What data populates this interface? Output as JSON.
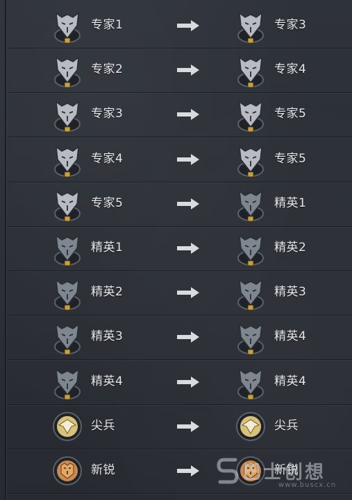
{
  "rank_table": {
    "arrow_icon": "right-arrow-icon",
    "rows": [
      {
        "from": {
          "label": "专家1",
          "badge": "expert-wolf-badge-icon",
          "tier": "I"
        },
        "to": {
          "label": "专家3",
          "badge": "expert-wolf-badge-icon",
          "tier": "III"
        }
      },
      {
        "from": {
          "label": "专家2",
          "badge": "expert-wolf-badge-icon",
          "tier": "II"
        },
        "to": {
          "label": "专家4",
          "badge": "expert-wolf-badge-icon",
          "tier": "IV"
        }
      },
      {
        "from": {
          "label": "专家3",
          "badge": "expert-wolf-badge-icon",
          "tier": "III"
        },
        "to": {
          "label": "专家5",
          "badge": "expert-wolf-badge-icon",
          "tier": "V"
        }
      },
      {
        "from": {
          "label": "专家4",
          "badge": "expert-wolf-badge-icon",
          "tier": "IV"
        },
        "to": {
          "label": "专家5",
          "badge": "expert-wolf-badge-icon",
          "tier": "V"
        }
      },
      {
        "from": {
          "label": "专家5",
          "badge": "expert-wolf-badge-icon",
          "tier": "V"
        },
        "to": {
          "label": "精英1",
          "badge": "elite-wolf-badge-icon",
          "tier": "I"
        }
      },
      {
        "from": {
          "label": "精英1",
          "badge": "elite-wolf-badge-icon",
          "tier": "I"
        },
        "to": {
          "label": "精英2",
          "badge": "elite-wolf-badge-icon",
          "tier": "II"
        }
      },
      {
        "from": {
          "label": "精英2",
          "badge": "elite-wolf-badge-icon",
          "tier": "II"
        },
        "to": {
          "label": "精英3",
          "badge": "elite-wolf-badge-icon",
          "tier": "III"
        }
      },
      {
        "from": {
          "label": "精英3",
          "badge": "elite-wolf-badge-icon",
          "tier": "III"
        },
        "to": {
          "label": "精英4",
          "badge": "elite-wolf-badge-icon",
          "tier": "IV"
        }
      },
      {
        "from": {
          "label": "精英4",
          "badge": "elite-wolf-badge-icon",
          "tier": "IV"
        },
        "to": {
          "label": "精英4",
          "badge": "elite-wolf-badge-icon",
          "tier": "IV"
        }
      },
      {
        "from": {
          "label": "尖兵",
          "badge": "vanguard-eagle-badge-icon",
          "tier": ""
        },
        "to": {
          "label": "尖兵",
          "badge": "vanguard-eagle-badge-icon",
          "tier": ""
        }
      },
      {
        "from": {
          "label": "新锐",
          "badge": "rookie-tiger-badge-icon",
          "tier": ""
        },
        "to": {
          "label": "新锐",
          "badge": "rookie-tiger-badge-icon",
          "tier": ""
        }
      }
    ]
  },
  "colors": {
    "background": "#2b2f35",
    "label_text": "#e6e8ea",
    "arrow": "#d9dcdf",
    "expert_badge": "#b8bcc2",
    "elite_badge": "#7e868f",
    "vanguard_badge": "#d8c27a",
    "rookie_badge": "#c98b4f"
  },
  "watermark": {
    "title": "巴士创想",
    "url": "www.buscx.cn",
    "logo": "s-logo-icon"
  }
}
